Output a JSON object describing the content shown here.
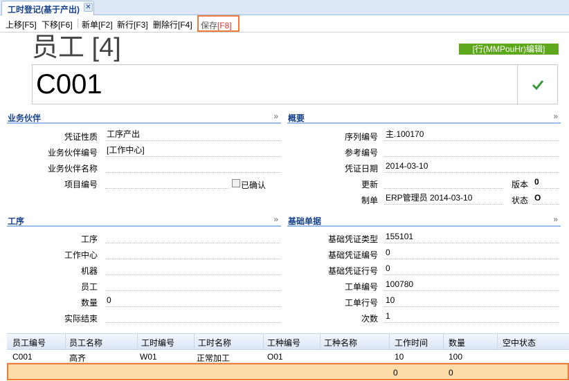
{
  "tab": {
    "title": "工时登记(基于产出)",
    "close": "✕"
  },
  "toolbar": {
    "up": "上移[F5]",
    "down": "下移[F6]",
    "new_doc": "新单[F2]",
    "new_row": "新行[F3]",
    "del_row": "删除行[F4]",
    "save_label": "保存",
    "save_key": "[F8]"
  },
  "header": {
    "title": "员工 [4]",
    "badge": "[行(MMPouHr)编辑]",
    "code": "C001"
  },
  "partner": {
    "title": "业务伙伴",
    "fields": [
      {
        "label": "凭证性质",
        "value": "工序产出"
      },
      {
        "label": "业务伙伴编号",
        "value": "[工作中心]"
      },
      {
        "label": "业务伙伴名称",
        "value": ""
      },
      {
        "label": "项目编号",
        "value": ""
      }
    ],
    "confirmed_label": "已确认"
  },
  "overview": {
    "title": "概要",
    "fields": [
      {
        "label": "序列编号",
        "value": "主.100170"
      },
      {
        "label": "参考编号",
        "value": ""
      },
      {
        "label": "凭证日期",
        "value": "2014-03-10"
      },
      {
        "label": "更新",
        "value": ""
      },
      {
        "label": "制单",
        "value": "ERP管理员 2014-03-10"
      }
    ],
    "version_label": "版本",
    "version_value": "0",
    "status_label": "状态",
    "status_value": "O"
  },
  "process": {
    "title": "工序",
    "fields": [
      {
        "label": "工序",
        "value": ""
      },
      {
        "label": "工作中心",
        "value": ""
      },
      {
        "label": "机器",
        "value": ""
      },
      {
        "label": "员工",
        "value": ""
      },
      {
        "label": "数量",
        "value": "0"
      },
      {
        "label": "实际结束",
        "value": ""
      }
    ]
  },
  "base": {
    "title": "基础单据",
    "fields": [
      {
        "label": "基础凭证类型",
        "value": "155101"
      },
      {
        "label": "基础凭证编号",
        "value": "0"
      },
      {
        "label": "基础凭证行号",
        "value": "0"
      },
      {
        "label": "工单编号",
        "value": "100780"
      },
      {
        "label": "工单行号",
        "value": "10"
      },
      {
        "label": "次数",
        "value": "1"
      }
    ]
  },
  "grid": {
    "columns": [
      "员工编号",
      "员工名称",
      "工时编号",
      "工时名称",
      "工种编号",
      "工种名称",
      "工作时间",
      "数量",
      "空中状态"
    ],
    "rows": [
      [
        "C001",
        "高齐",
        "W01",
        "正常加工",
        "O01",
        "",
        "10",
        "100",
        ""
      ]
    ],
    "totals": [
      "",
      "",
      "",
      "",
      "",
      "",
      "0",
      "0",
      ""
    ]
  },
  "chevron": "»"
}
